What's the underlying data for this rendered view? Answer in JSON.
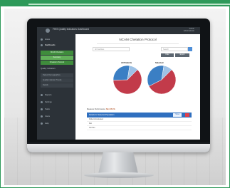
{
  "app": {
    "title": "FHIS Quality Indicators Dashboard",
    "user_line1": "Admin",
    "user_line2": "Administrator"
  },
  "sidebar": {
    "items": [
      {
        "label": "Home"
      },
      {
        "label": "Dashboards"
      },
      {
        "label": "Reports"
      },
      {
        "label": "Settings"
      },
      {
        "label": "Tasks"
      },
      {
        "label": "Users"
      },
      {
        "label": "Help"
      }
    ],
    "sub": [
      "NCAM Chelation",
      "Summary",
      "Chelation Protocol"
    ],
    "section_label": "Quality Indicators",
    "section_items": [
      "Patient Demographics",
      "Quality Indicator Trends",
      "Details"
    ]
  },
  "main": {
    "page_title": "NCAM Chelation Protocol",
    "select_placeholder": "All Facilities",
    "search_placeholder": "Search",
    "buttons": [
      "Filter",
      "Export"
    ],
    "charts": [
      {
        "title": "All Patients"
      },
      {
        "title": "Selected"
      }
    ],
    "table": {
      "caption_prefix": "Measure Performance:",
      "caption_value": "Met 45.0%",
      "header": "Details for Selected Population",
      "pill": "Show",
      "rows": [
        "Patients Evaluated",
        "Met",
        "Not Met"
      ]
    }
  },
  "colors": {
    "accent_green": "#3f8c3c",
    "header_blue": "#2f6fbf",
    "pie_red": "#c23b4a",
    "pie_blue": "#3b7fc4",
    "pie_light": "#9ec2e6"
  },
  "chart_data": [
    {
      "type": "pie",
      "categories": [
        "Met",
        "Not Met",
        "Excluded"
      ],
      "values": [
        62,
        28,
        10
      ]
    },
    {
      "type": "pie",
      "categories": [
        "Met",
        "Not Met",
        "Excluded"
      ],
      "values": [
        55,
        35,
        10
      ]
    }
  ]
}
